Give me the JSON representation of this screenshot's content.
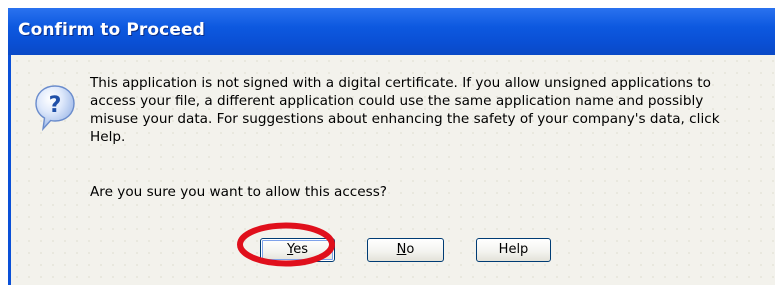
{
  "dialog": {
    "title": "Confirm to Proceed",
    "icon": "question-icon",
    "message": "This application is not signed with a digital certificate.  If you allow unsigned applications to\naccess your file, a different application could use the same application name and possibly\nmisuse your data.  For suggestions about enhancing the safety of your company's data, click\nHelp.",
    "question": "Are you sure you want to allow this access?"
  },
  "buttons": {
    "yes": {
      "mnemonic": "Y",
      "rest": "es"
    },
    "no": {
      "mnemonic": "N",
      "rest": "o"
    },
    "help": {
      "label": "Help"
    }
  },
  "annotation": {
    "shape": "ellipse",
    "color": "#e0101c",
    "target": "yes-button"
  },
  "colors": {
    "titlebar": "#0a50d8",
    "client": "#f3f2ec",
    "button_border": "#003c74"
  }
}
